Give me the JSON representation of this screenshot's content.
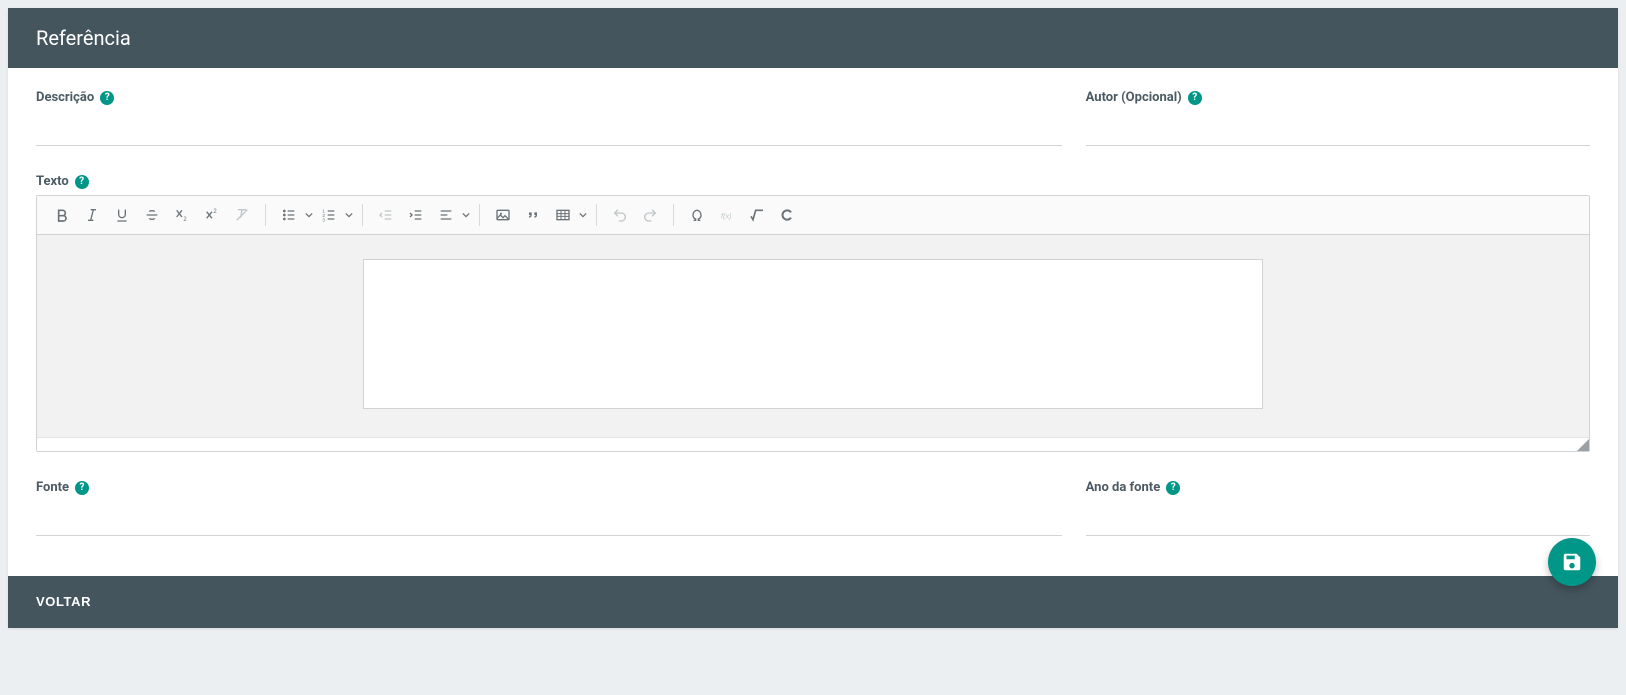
{
  "header": {
    "title": "Referência"
  },
  "fields": {
    "descricao": {
      "label": "Descrição",
      "value": ""
    },
    "autor": {
      "label": "Autor (Opcional)",
      "value": ""
    },
    "texto": {
      "label": "Texto"
    },
    "fonte": {
      "label": "Fonte",
      "value": ""
    },
    "anoFonte": {
      "label": "Ano da fonte",
      "value": ""
    }
  },
  "footer": {
    "back": "VOLTAR"
  },
  "colors": {
    "accent": "#009688",
    "headerBg": "#45555e"
  }
}
